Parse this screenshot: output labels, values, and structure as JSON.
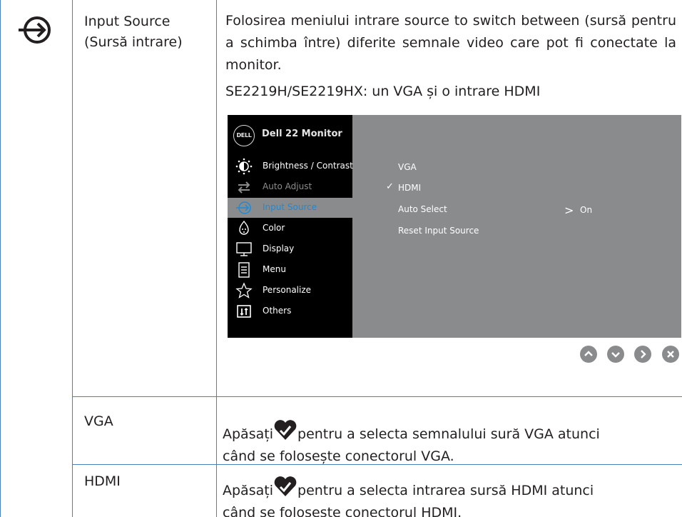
{
  "row_input_source": {
    "label_line1": "Input Source",
    "label_line2": "(Sursă intrare)",
    "description": "Folosirea meniului intrare source to switch between (sursă pentru a schimba între) diferite semnale video care pot fi conectate la monitor.",
    "models_note": "SE2219H/SE2219HX: un VGA și o intrare HDMI"
  },
  "osd": {
    "logo_text": "DELL",
    "title": "Dell 22 Monitor",
    "menu": [
      {
        "label": "Brightness / Contrast",
        "icon": "brightness-icon",
        "state": "normal"
      },
      {
        "label": "Auto Adjust",
        "icon": "auto-adjust-icon",
        "state": "disabled"
      },
      {
        "label": "Input Source",
        "icon": "input-source-icon",
        "state": "active"
      },
      {
        "label": "Color",
        "icon": "color-icon",
        "state": "normal"
      },
      {
        "label": "Display",
        "icon": "display-icon",
        "state": "normal"
      },
      {
        "label": "Menu",
        "icon": "menu-icon",
        "state": "normal"
      },
      {
        "label": "Personalize",
        "icon": "star-icon",
        "state": "normal"
      },
      {
        "label": "Others",
        "icon": "others-icon",
        "state": "normal"
      }
    ],
    "options": [
      {
        "label": "VGA",
        "selected": false
      },
      {
        "label": "HDMI",
        "selected": true
      },
      {
        "label": "Auto Select",
        "selected": false,
        "value": "On"
      },
      {
        "label": "Reset Input Source",
        "selected": false
      }
    ],
    "auto_select_value": "On",
    "nav_buttons": [
      "up-button-icon",
      "down-button-icon",
      "right-button-icon",
      "close-button-icon"
    ]
  },
  "row_vga": {
    "label": "VGA",
    "text_before_icon": "Apăsați ",
    "text_after_icon": "pentru a  selecta semnalului sură VGA atunci",
    "line2": "când se folosește conectorul VGA."
  },
  "row_hdmi": {
    "label": "HDMI",
    "text_before_icon": "Apăsați ",
    "text_after_icon": "pentru a selecta intrarea sursă HDMI atunci",
    "line2": "când se folosește conectorul HDMI."
  },
  "colors": {
    "grid": "#4d7fb8",
    "osd_bg": "#8a8b8d",
    "osd_panel": "#000000",
    "active_blue": "#1e8ad6",
    "nav_button": "#8a8b8d"
  }
}
